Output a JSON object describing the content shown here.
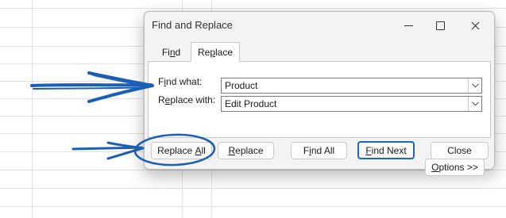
{
  "dialog": {
    "title": "Find and Replace",
    "tabs": [
      {
        "pre": "Fi",
        "key": "n",
        "post": "d"
      },
      {
        "pre": "Re",
        "key": "p",
        "post": "lace"
      }
    ],
    "find_label": {
      "pre": "F",
      "key": "i",
      "post": "nd what:"
    },
    "find_value": "Product",
    "replace_label": {
      "pre": "R",
      "key": "e",
      "post": "place with:"
    },
    "replace_value": "Edit Product",
    "buttons": {
      "options": {
        "pre": "",
        "key": "O",
        "post": "ptions >>"
      },
      "replace_all": {
        "pre": "Replace ",
        "key": "A",
        "post": "ll"
      },
      "replace": {
        "pre": "",
        "key": "R",
        "post": "eplace"
      },
      "find_all": {
        "pre": "F",
        "key": "i",
        "post": "nd All"
      },
      "find_next": {
        "pre": "",
        "key": "F",
        "post": "ind Next"
      },
      "close": "Close"
    },
    "accent_color": "#1d66c0"
  },
  "annotations": {
    "color": "#1a5fb4",
    "icons": [
      "arrow-annotation-icon",
      "circle-annotation-icon"
    ]
  }
}
